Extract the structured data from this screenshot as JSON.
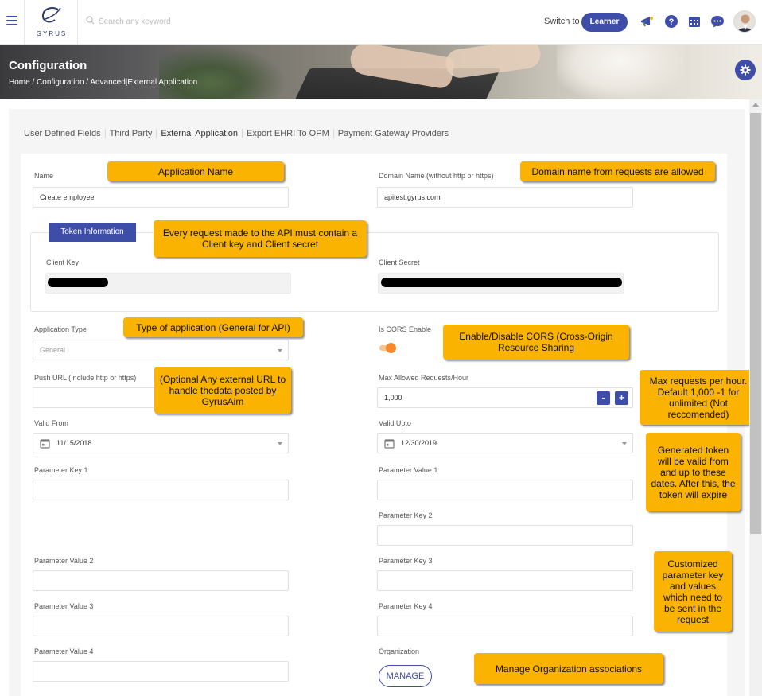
{
  "header": {
    "logo_text": "GYRUS",
    "search_placeholder": "Search any keyword",
    "switch_label": "Switch to",
    "learner_label": "Learner"
  },
  "banner": {
    "title": "Configuration",
    "breadcrumb": [
      "Home",
      "/",
      "Configuration",
      "/",
      "Advanced",
      "|",
      "External Application"
    ]
  },
  "tabs": [
    "User Defined Fields",
    "Third Party",
    "External Application",
    "Export EHRI To OPM",
    "Payment Gateway Providers"
  ],
  "active_tab": "External Application",
  "form": {
    "name_label": "Name",
    "name_value": "Create employee",
    "domain_label": "Domain Name (without http or https)",
    "domain_value": "apitest.gyrus.com",
    "token_button": "Token Information",
    "client_key_label": "Client Key",
    "client_secret_label": "Client Secret",
    "app_type_label": "Application Type",
    "app_type_value": "General",
    "cors_label": "Is CORS Enable",
    "cors_enabled": true,
    "push_url_label": "Push URL (Include http or https)",
    "push_url_value": "",
    "max_requests_label": "Max Allowed Requests/Hour",
    "max_requests_value": "1,000",
    "stepper_minus": "-",
    "stepper_plus": "+",
    "valid_from_label": "Valid From",
    "valid_from_value": "11/15/2018",
    "valid_upto_label": "Valid Upto",
    "valid_upto_value": "12/30/2019",
    "param_key1_label": "Parameter Key 1",
    "param_value1_label": "Parameter Value 1",
    "param_key2_label": "Parameter Key 2",
    "param_value2_label": "Parameter Value 2",
    "param_key3_label": "Parameter Key 3",
    "param_value3_label": "Parameter Value 3",
    "param_key4_label": "Parameter Key 4",
    "param_value4_label": "Parameter Value 4",
    "organization_label": "Organization",
    "manage_button": "MANAGE"
  },
  "callouts": {
    "app_name": "Application Name",
    "domain": "Domain name from requests are allowed",
    "token": "Every request made to the API must contain a Client key and Client secret",
    "app_type": "Type of application (General for API)",
    "cors": "Enable/Disable CORS (Cross-Origin Resource Sharing",
    "push_url": "(Optional Any external URL to handle thedata posted by GyrusAim",
    "max_requests": "Max requests per hour. Default 1,000 -1 for unlimited (Not reccomended)",
    "validity": "Generated token will be valid from and up to these dates. After this, the token will expire",
    "parameters": "Customized parameter key and values which need to be sent in the request",
    "organization": "Manage Organization associations"
  },
  "colors": {
    "primary": "#3e4da8",
    "callout": "#f9b300",
    "toggle": "#f5892b"
  },
  "icons": [
    "menu-icon",
    "search-icon",
    "megaphone-icon",
    "help-icon",
    "calendar-icon",
    "chat-icon",
    "gear-icon"
  ]
}
